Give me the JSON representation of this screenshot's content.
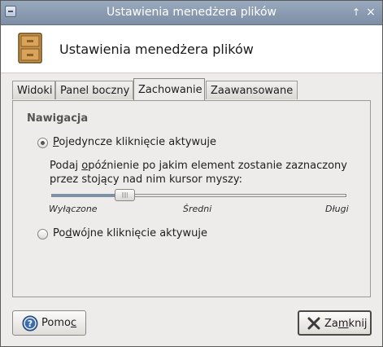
{
  "window": {
    "title": "Ustawienia menedżera plików"
  },
  "titlebar_buttons": {
    "shade_icon": "↑",
    "close_icon": "×"
  },
  "header": {
    "title": "Ustawienia menedżera plików",
    "icon": "file-cabinet-icon"
  },
  "tabs": [
    {
      "label": "Widoki",
      "active": false
    },
    {
      "label": "Panel boczny",
      "active": false
    },
    {
      "label": "Zachowanie",
      "active": true
    },
    {
      "label": "Zaawansowane",
      "active": false
    }
  ],
  "navigation": {
    "section_title": "Nawigacja",
    "single_click": {
      "label_pre": "",
      "mnemonic": "P",
      "label_post": "ojedyncze kliknięcie aktywuje",
      "checked": true
    },
    "delay_description_1_pre": "Podaj ",
    "delay_description_1_mn": "o",
    "delay_description_1_post": "późnienie po jakim element zostanie zaznaczony",
    "delay_description_2": "przez stojący nad nim kursor myszy:",
    "slider": {
      "value_fraction": 0.25,
      "tick_off": "Wyłączone",
      "tick_mid": "Średni",
      "tick_long": "Długi"
    },
    "double_click": {
      "label_pre": "Po",
      "mnemonic": "d",
      "label_post": "wójne kliknięcie aktywuje",
      "checked": false
    }
  },
  "buttons": {
    "help": {
      "label_pre": "Pomo",
      "mnemonic": "c",
      "icon": "help-icon"
    },
    "close": {
      "label_pre": "Za",
      "mnemonic": "m",
      "label_post": "knij",
      "icon": "close-x-icon"
    }
  }
}
